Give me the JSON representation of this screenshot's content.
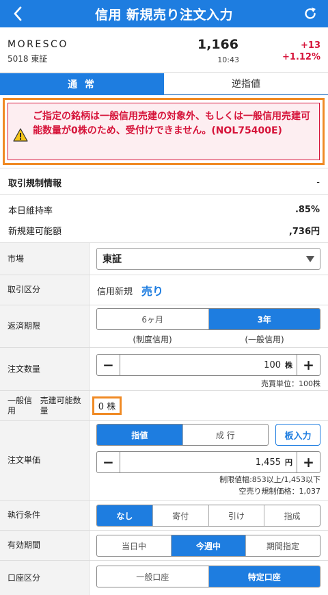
{
  "header": {
    "title": "信用 新規売り注文入力"
  },
  "stock": {
    "name": "MORESCO",
    "code_market": "5018 東証",
    "price": "1,166",
    "time": "10:43",
    "change": "+13",
    "change_pct": "+1.12%"
  },
  "tabs": [
    {
      "label": "通 常"
    },
    {
      "label": "逆指値"
    }
  ],
  "alert": {
    "message": "ご指定の銘柄は一般信用売建の対象外、もしくは一般信用売建可能数量が0株のため、受付けできません。(NOL75400E)"
  },
  "regulation": {
    "label": "取引規制情報",
    "value": "-"
  },
  "account": {
    "maintenance_label": "本日維持率",
    "maintenance_value": ".85%",
    "capacity_label": "新規建可能額",
    "capacity_value": ",736円"
  },
  "form": {
    "market": {
      "label": "市場",
      "value": "東証"
    },
    "trade_type": {
      "label": "取引区分",
      "kind": "信用新規",
      "side": "売り"
    },
    "repay": {
      "label": "返済期限",
      "options": [
        "6ヶ月",
        "3年"
      ],
      "subs": [
        "(制度信用)",
        "(一般信用)"
      ],
      "selected": 1
    },
    "quantity": {
      "label": "注文数量",
      "value": "100",
      "unit": "株",
      "note": "売買単位：100株"
    },
    "available": {
      "label_line1": "一般信用",
      "label_line2": "売建可能数量",
      "value": "0 株"
    },
    "price": {
      "label": "注文単価",
      "type_options": [
        "指値",
        "成 行"
      ],
      "board_button": "板入力",
      "value": "1,455",
      "unit": "円",
      "range_note": "制限値幅:853以上/1,453以下",
      "short_note": "空売り規制価格：1,037"
    },
    "condition": {
      "label": "執行条件",
      "options": [
        "なし",
        "寄付",
        "引け",
        "指成"
      ]
    },
    "period": {
      "label": "有効期間",
      "options": [
        "当日中",
        "今週中",
        "期間指定"
      ]
    },
    "account_type": {
      "label": "口座区分",
      "options": [
        "一般口座",
        "特定口座"
      ]
    }
  },
  "colors": {
    "primary": "#1e7de0",
    "alert_red": "#d6143a",
    "highlight_orange": "#f08a24"
  },
  "icons": [
    "back-arrow-icon",
    "refresh-icon",
    "warning-icon",
    "dropdown-caret-icon"
  ]
}
